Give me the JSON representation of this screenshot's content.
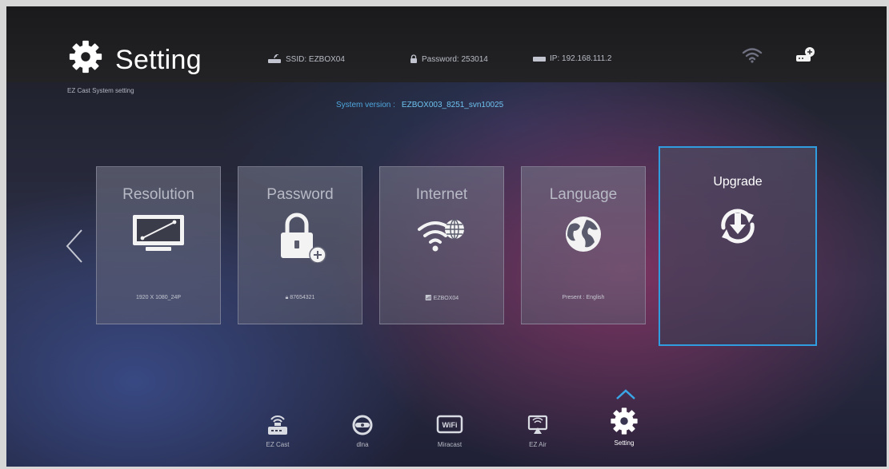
{
  "header": {
    "title": "Setting",
    "subtitle": "EZ Cast System setting",
    "ssid": "SSID: EZBOX04",
    "password": "Password: 253014",
    "ip": "IP: 192.168.111.2",
    "version_label": "System version :",
    "version_value": "EZBOX003_8251_svn10025"
  },
  "cards": [
    {
      "title": "Resolution",
      "value": "1920 X 1080_24P",
      "icon": "monitor-icon"
    },
    {
      "title": "Password",
      "value": "87654321",
      "icon": "lock-icon"
    },
    {
      "title": "Internet",
      "value": "EZBOX04",
      "icon": "wifi-globe-icon"
    },
    {
      "title": "Language",
      "value": "Present : English",
      "icon": "globe-icon"
    },
    {
      "title": "Upgrade",
      "value": "",
      "icon": "upgrade-icon"
    }
  ],
  "dock": [
    {
      "label": "EZ Cast",
      "icon": "router-icon"
    },
    {
      "label": "dlna",
      "icon": "dlna-icon"
    },
    {
      "label": "Miracast",
      "icon": "miracast-icon"
    },
    {
      "label": "EZ Air",
      "icon": "airplay-icon"
    },
    {
      "label": "Setting",
      "icon": "gear-icon"
    }
  ],
  "colors": {
    "accent": "#2f9de0",
    "version_text": "#6ec3f0"
  }
}
